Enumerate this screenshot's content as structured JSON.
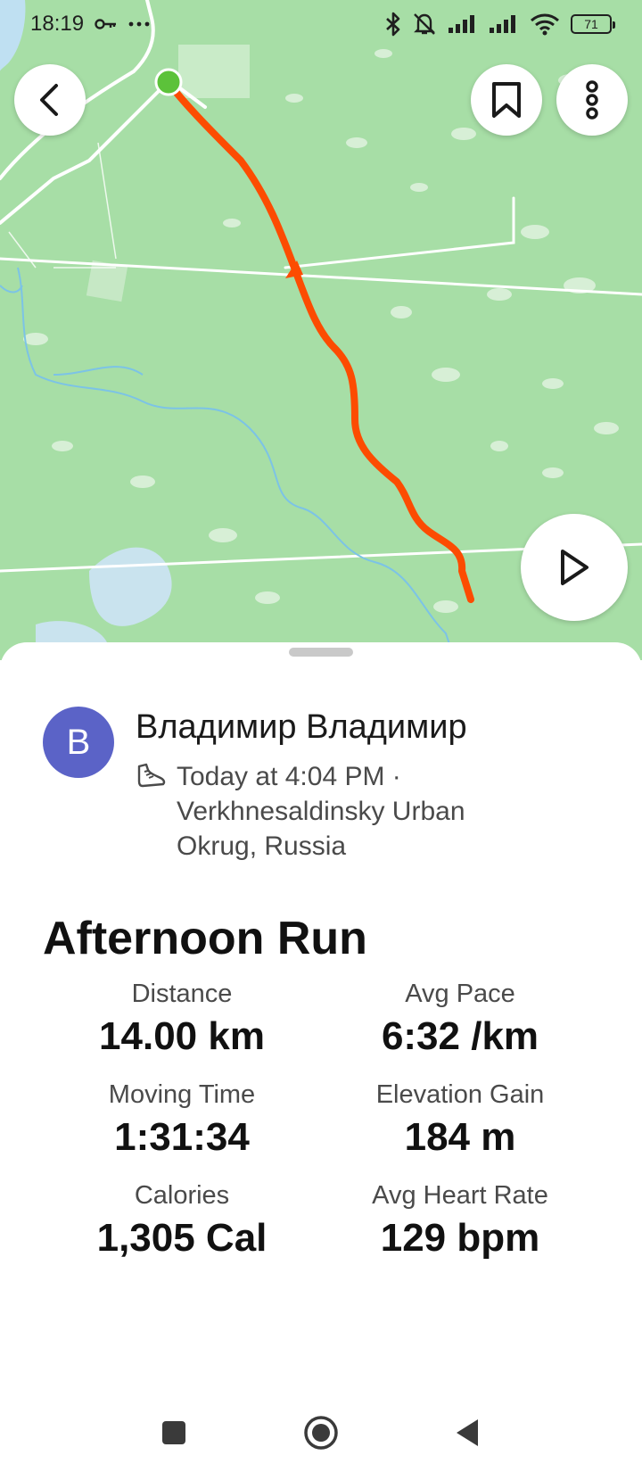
{
  "status_bar": {
    "time": "18:19",
    "battery": "71",
    "icons": [
      "key-icon",
      "more-dots-icon",
      "bluetooth-icon",
      "bell-off-icon",
      "signal-icon",
      "signal-icon",
      "wifi-icon",
      "battery-icon"
    ]
  },
  "map": {
    "route_color": "#fc4c02",
    "start_marker_color": "#5cc23a",
    "buttons": [
      "back-icon",
      "bookmark-icon",
      "more-vertical-icon",
      "play-icon"
    ]
  },
  "activity": {
    "athlete_initial": "B",
    "athlete_name": "Владимир Владимир",
    "avatar_color": "#5b63c7",
    "sport_icon": "shoe-icon",
    "timestamp_location": "Today at 4:04 PM · Verkhnesaldinsky Urban Okrug, Russia",
    "title": "Afternoon Run"
  },
  "stats": [
    {
      "label": "Distance",
      "value": "14.00 km"
    },
    {
      "label": "Avg Pace",
      "value": "6:32 /km"
    },
    {
      "label": "Moving Time",
      "value": "1:31:34"
    },
    {
      "label": "Elevation Gain",
      "value": "184 m"
    },
    {
      "label": "Calories",
      "value": "1,305 Cal"
    },
    {
      "label": "Avg Heart Rate",
      "value": "129 bpm"
    }
  ],
  "nav_bar": {
    "icons": [
      "recents-square-icon",
      "home-circle-icon",
      "back-triangle-icon"
    ]
  }
}
